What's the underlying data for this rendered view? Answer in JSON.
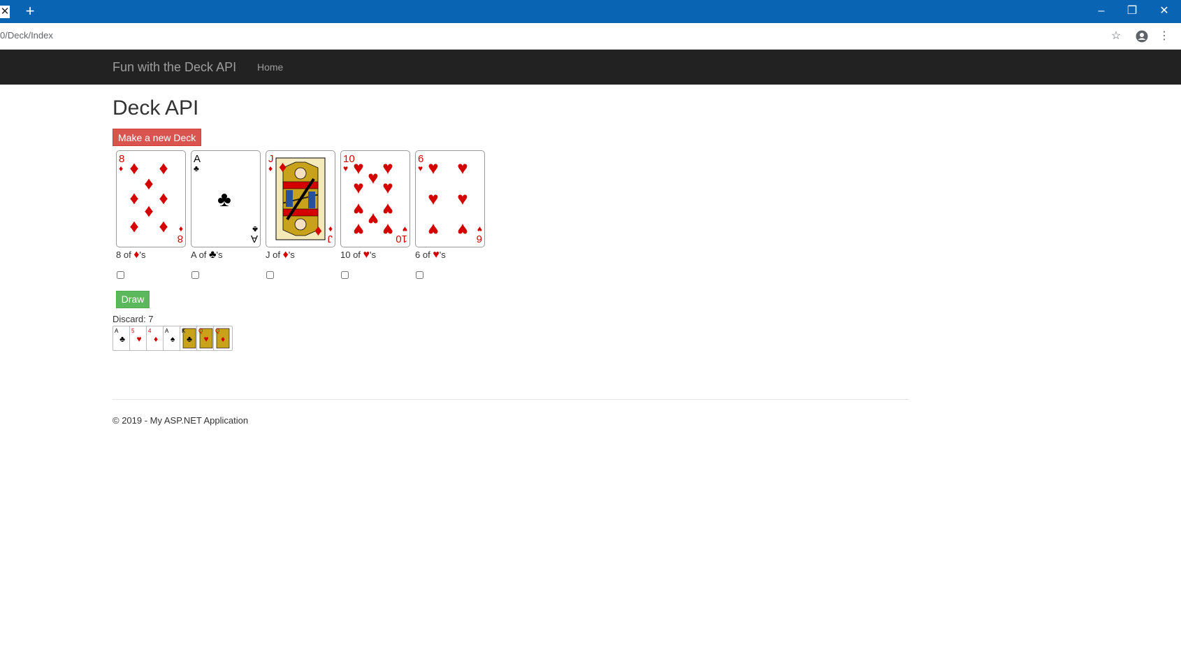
{
  "browser": {
    "tab_close_icon": "close-icon",
    "new_tab_icon": "plus-icon",
    "url": "0/Deck/Index",
    "window_controls": [
      "minimize-icon",
      "restore-icon",
      "close-icon"
    ],
    "address_icons": [
      "star-icon",
      "account-icon",
      "more-vert-icon"
    ]
  },
  "navbar": {
    "brand": "Fun with the Deck API",
    "links": [
      "Home"
    ]
  },
  "main": {
    "title": "Deck API",
    "new_deck_label": "Make a new Deck",
    "draw_label": "Draw",
    "discard_label": "Discard: 7"
  },
  "cards": [
    {
      "rank_text": "8",
      "suit": "diamonds",
      "caption_prefix": "8 of ",
      "caption_suffix": "'s",
      "suit_glyph": "♦",
      "checked": false
    },
    {
      "rank_text": "A",
      "suit": "clubs",
      "caption_prefix": "A of ",
      "caption_suffix": "'s",
      "suit_glyph": "♣",
      "checked": false
    },
    {
      "rank_text": "J",
      "suit": "diamonds",
      "caption_prefix": "J of ",
      "caption_suffix": "'s",
      "suit_glyph": "♦",
      "checked": false
    },
    {
      "rank_text": "10",
      "suit": "hearts",
      "caption_prefix": "10 of ",
      "caption_suffix": "'s",
      "suit_glyph": "♥",
      "checked": false
    },
    {
      "rank_text": "6",
      "suit": "hearts",
      "caption_prefix": "6 of ",
      "caption_suffix": "'s",
      "suit_glyph": "♥",
      "checked": false
    }
  ],
  "discard_pile": [
    {
      "rank_text": "A",
      "suit": "clubs"
    },
    {
      "rank_text": "5",
      "suit": "hearts"
    },
    {
      "rank_text": "4",
      "suit": "diamonds"
    },
    {
      "rank_text": "A",
      "suit": "spades"
    },
    {
      "rank_text": "K",
      "suit": "clubs"
    },
    {
      "rank_text": "Q",
      "suit": "hearts"
    },
    {
      "rank_text": "Q",
      "suit": "diamonds"
    }
  ],
  "colors": {
    "tabbar": "#0a64b4",
    "navbar": "#222222",
    "danger": "#d9534f",
    "success": "#5cb85c",
    "red_suit": "#d40000",
    "black_suit": "#000000"
  },
  "footer": {
    "text": "© 2019 - My ASP.NET Application"
  }
}
